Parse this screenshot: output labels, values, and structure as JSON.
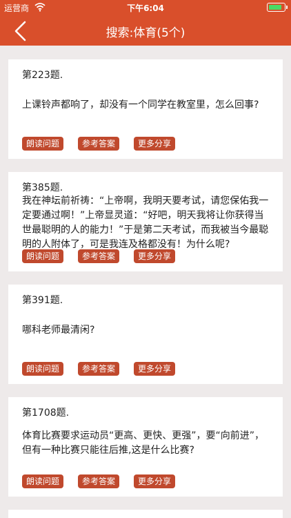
{
  "status": {
    "carrier": "运营商",
    "time": "下午6:04"
  },
  "nav": {
    "title": "搜索:体育(5个)"
  },
  "buttons": {
    "read": "朗读问题",
    "answer": "参考答案",
    "share": "更多分享"
  },
  "questions": [
    {
      "number": "第223题.",
      "text": "上课铃声都响了，却没有一个同学在教室里，怎么回事?"
    },
    {
      "number": "第385题.",
      "text": "我在神坛前祈祷：“上帝啊，我明天要考试，请您保佑我一定要通过啊！”上帝显灵道：“好吧，明天我将让你获得当世最聪明的人的能力！”于是第二天考试，而我被当今最聪明的人附体了，可是我连及格都没有！为什么呢?"
    },
    {
      "number": "第391题.",
      "text": "哪科老师最清闲?"
    },
    {
      "number": "第1708题.",
      "text": "体育比赛要求运动员“更高、更快、更强”，要“向前进”，但有一种比赛只能往后推,这是什么比赛?"
    }
  ]
}
